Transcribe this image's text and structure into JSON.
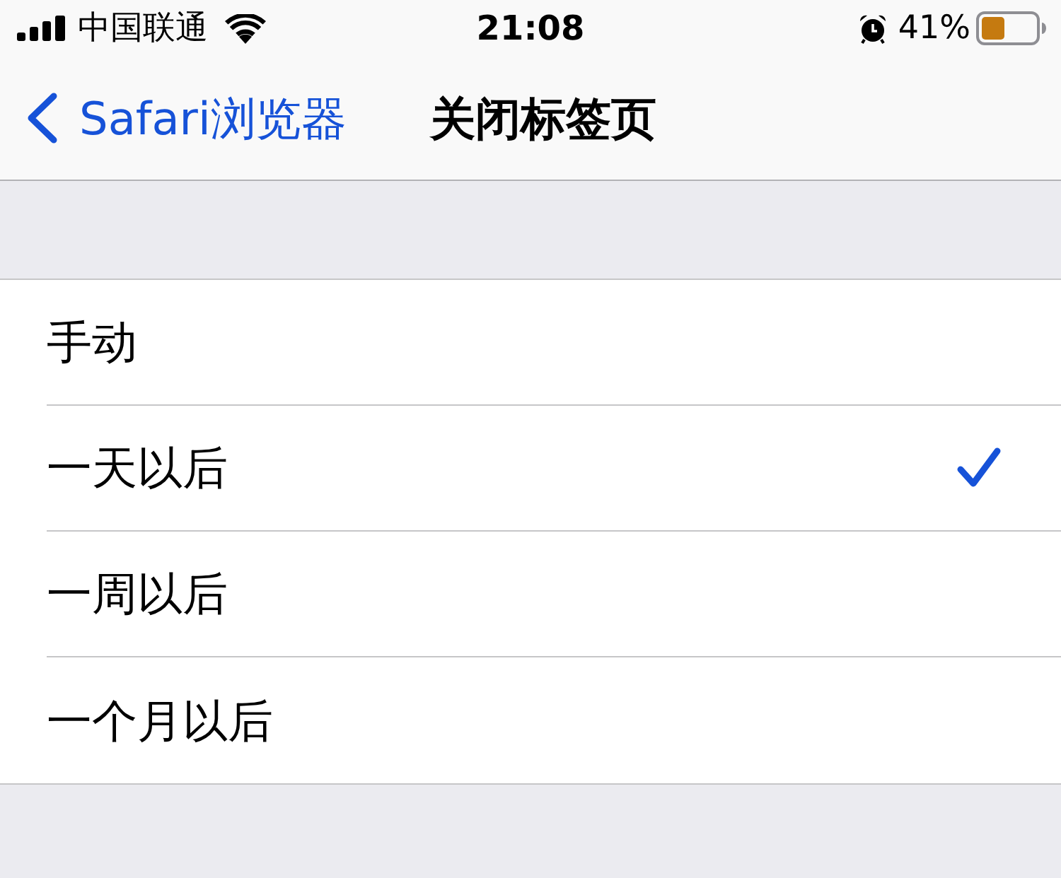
{
  "status_bar": {
    "carrier": "中国联通",
    "time": "21:08",
    "battery": "41%"
  },
  "nav_bar": {
    "back": "Safari浏览器",
    "title": "关闭标签页"
  },
  "options": [
    {
      "label": "手动",
      "selected": false
    },
    {
      "label": "一天以后",
      "selected": true
    },
    {
      "label": "一周以后",
      "selected": false
    },
    {
      "label": "一个月以后",
      "selected": false
    }
  ]
}
